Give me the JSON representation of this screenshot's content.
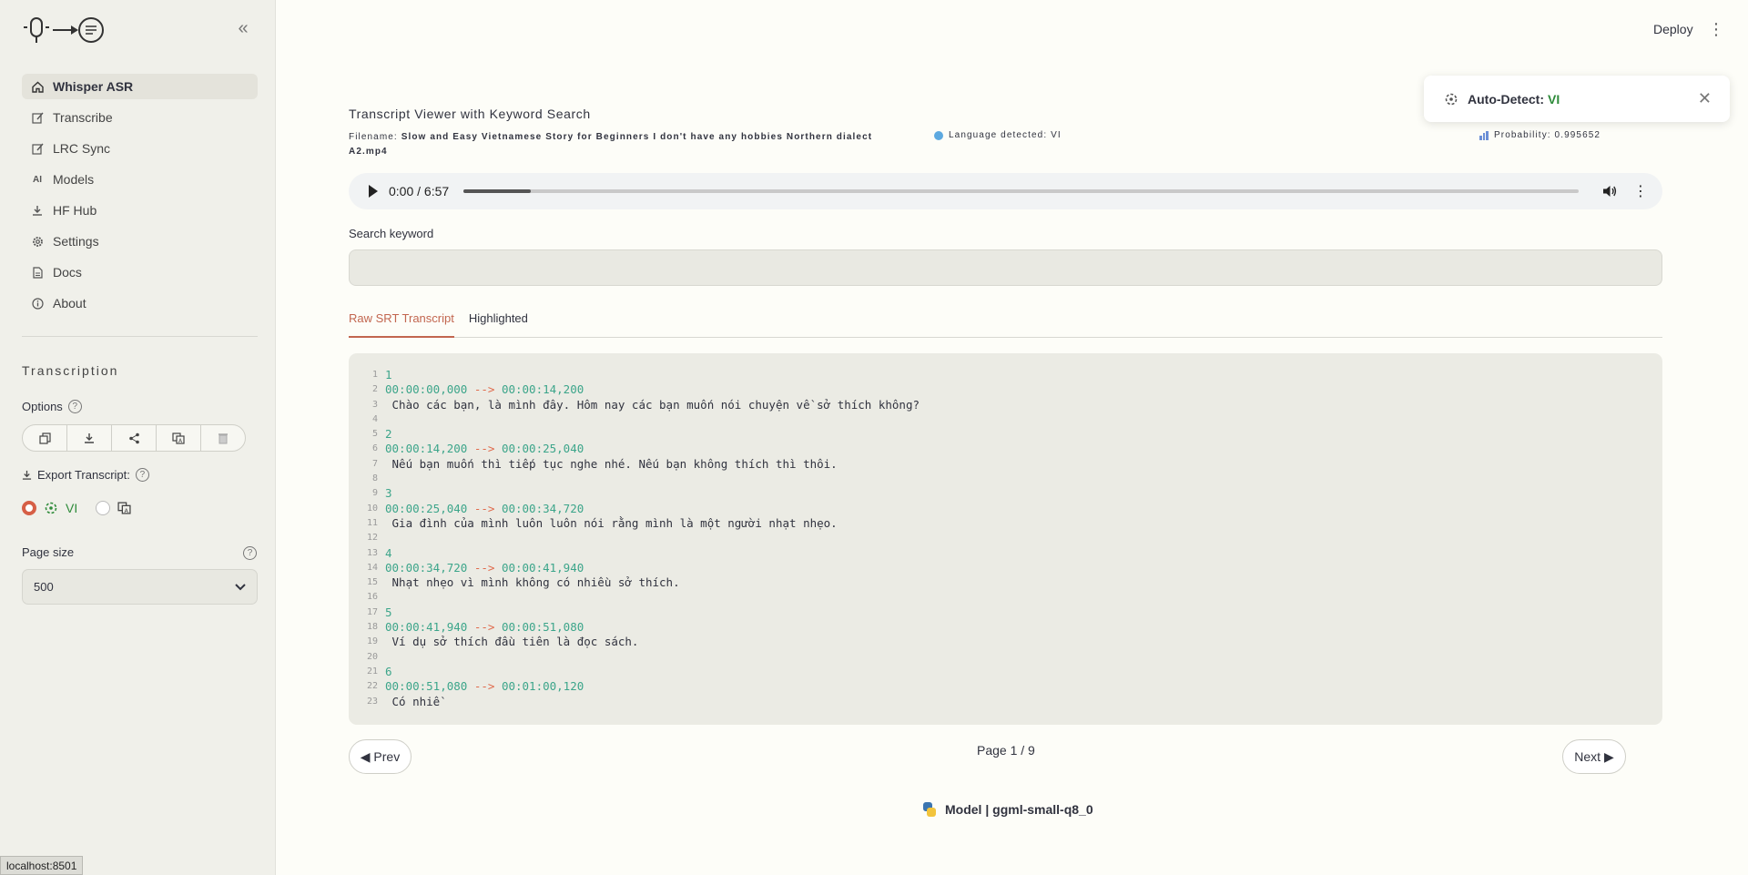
{
  "sidebar": {
    "nav": [
      {
        "label": "Whisper ASR",
        "icon": "home-icon",
        "active": true
      },
      {
        "label": "Transcribe",
        "icon": "edit-icon"
      },
      {
        "label": "LRC Sync",
        "icon": "sync-icon"
      },
      {
        "label": "Models",
        "icon": "ai-icon"
      },
      {
        "label": "HF Hub",
        "icon": "download-icon"
      },
      {
        "label": "Settings",
        "icon": "gear-icon"
      },
      {
        "label": "Docs",
        "icon": "document-icon"
      },
      {
        "label": "About",
        "icon": "info-icon"
      }
    ],
    "section_title": "Transcription",
    "options_label": "Options",
    "export_label": "Export Transcript:",
    "radio_vi_label": "VI",
    "page_size_label": "Page size",
    "page_size_value": "500"
  },
  "header": {
    "deploy_label": "Deploy"
  },
  "toast": {
    "label": "Auto-Detect:",
    "value": "VI"
  },
  "main": {
    "title": "Transcript Viewer with Keyword Search",
    "filename_label": "Filename:",
    "filename_value": "Slow and Easy Vietnamese Story for Beginners I don't have any hobbies Northern dialect A2.mp4",
    "language_label": "Language detected: VI",
    "probability_label": "Probability: 0.995652",
    "audio_time": "0:00 / 6:57",
    "audio_progress": 0.06,
    "search_label": "Search keyword",
    "search_value": "",
    "tabs": [
      {
        "label": "Raw SRT Transcript",
        "active": true
      },
      {
        "label": "Highlighted",
        "active": false
      }
    ],
    "prev_label": "◀ Prev",
    "next_label": "Next ▶",
    "page_info": "Page 1 / 9",
    "model_info": "Model | ggml-small-q8_0"
  },
  "transcript": [
    {
      "type": "index",
      "text": "1"
    },
    {
      "type": "time",
      "start": "00:00:00,000",
      "end": "00:00:14,200"
    },
    {
      "type": "text",
      "text": " Chào các bạn, là mình đây. Hôm nay các bạn muốn nói chuyện về sở thích không?"
    },
    {
      "type": "blank",
      "text": ""
    },
    {
      "type": "index",
      "text": "2"
    },
    {
      "type": "time",
      "start": "00:00:14,200",
      "end": "00:00:25,040"
    },
    {
      "type": "text",
      "text": " Nếu bạn muốn thì tiếp tục nghe nhé. Nếu bạn không thích thì thôi."
    },
    {
      "type": "blank",
      "text": ""
    },
    {
      "type": "index",
      "text": "3"
    },
    {
      "type": "time",
      "start": "00:00:25,040",
      "end": "00:00:34,720"
    },
    {
      "type": "text",
      "text": " Gia đình của mình luôn luôn nói rằng mình là một người nhạt nhẹo."
    },
    {
      "type": "blank",
      "text": ""
    },
    {
      "type": "index",
      "text": "4"
    },
    {
      "type": "time",
      "start": "00:00:34,720",
      "end": "00:00:41,940"
    },
    {
      "type": "text",
      "text": " Nhạt nhẹo vì mình không có nhiều sở thích."
    },
    {
      "type": "blank",
      "text": ""
    },
    {
      "type": "index",
      "text": "5"
    },
    {
      "type": "time",
      "start": "00:00:41,940",
      "end": "00:00:51,080"
    },
    {
      "type": "text",
      "text": " Ví dụ sở thích đầu tiên là đọc sách."
    },
    {
      "type": "blank",
      "text": ""
    },
    {
      "type": "index",
      "text": "6"
    },
    {
      "type": "time",
      "start": "00:00:51,080",
      "end": "00:01:00,120"
    },
    {
      "type": "text",
      "text": " Có nhiề"
    }
  ],
  "status_url": "localhost:8501",
  "colors": {
    "accent": "#c2664f",
    "radio_on": "#d65f46",
    "timestamp": "#3ca58a",
    "arrow": "#e06a4c",
    "vi_green": "#2e8b3a"
  }
}
